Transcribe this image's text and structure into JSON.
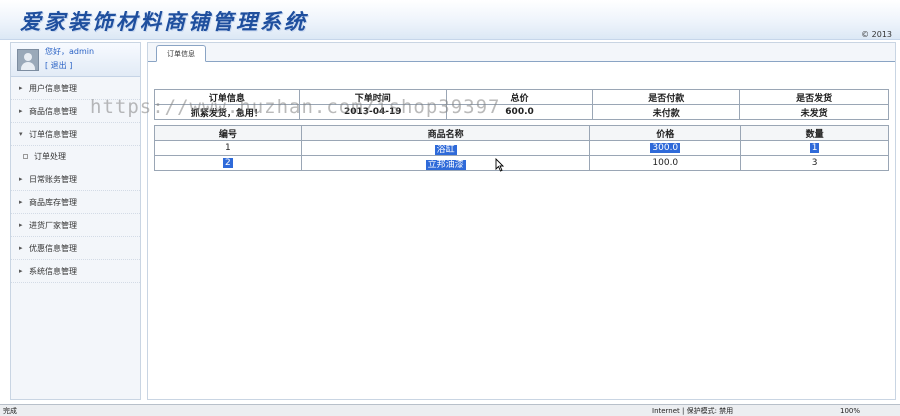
{
  "header": {
    "app_title": "爱家装饰材料商铺管理系统",
    "copyright": "© 2013"
  },
  "sidebar": {
    "greeting": "您好，admin",
    "logout": "[ 退出 ]",
    "menu": [
      {
        "label": "用户信息管理"
      },
      {
        "label": "商品信息管理"
      },
      {
        "label": "订单信息管理",
        "expanded": true
      },
      {
        "label": "订单处理",
        "sub": true
      },
      {
        "label": "日常账务管理"
      },
      {
        "label": "商品库存管理"
      },
      {
        "label": "进货厂家管理"
      },
      {
        "label": "优惠信息管理"
      },
      {
        "label": "系统信息管理"
      }
    ]
  },
  "main": {
    "tab_label": "订单信息",
    "order_table": {
      "headers": [
        "订单信息",
        "下单时间",
        "总价",
        "是否付款",
        "是否发货"
      ],
      "row": [
        "抓紧发货，急用！",
        "2013-04-19",
        "600.0",
        "未付款",
        "未发货"
      ]
    },
    "items_table": {
      "headers": [
        "编号",
        "商品名称",
        "价格",
        "数量"
      ],
      "rows": [
        [
          "1",
          "浴缸",
          "300.0",
          "1"
        ],
        [
          "2",
          "立邦油漆",
          "100.0",
          "3"
        ]
      ]
    }
  },
  "watermark": "https://www.huzhan.com/ishop39397",
  "statusbar": {
    "left": "完成",
    "zone": "Internet | 保护模式: 禁用",
    "zoom": "100%"
  }
}
